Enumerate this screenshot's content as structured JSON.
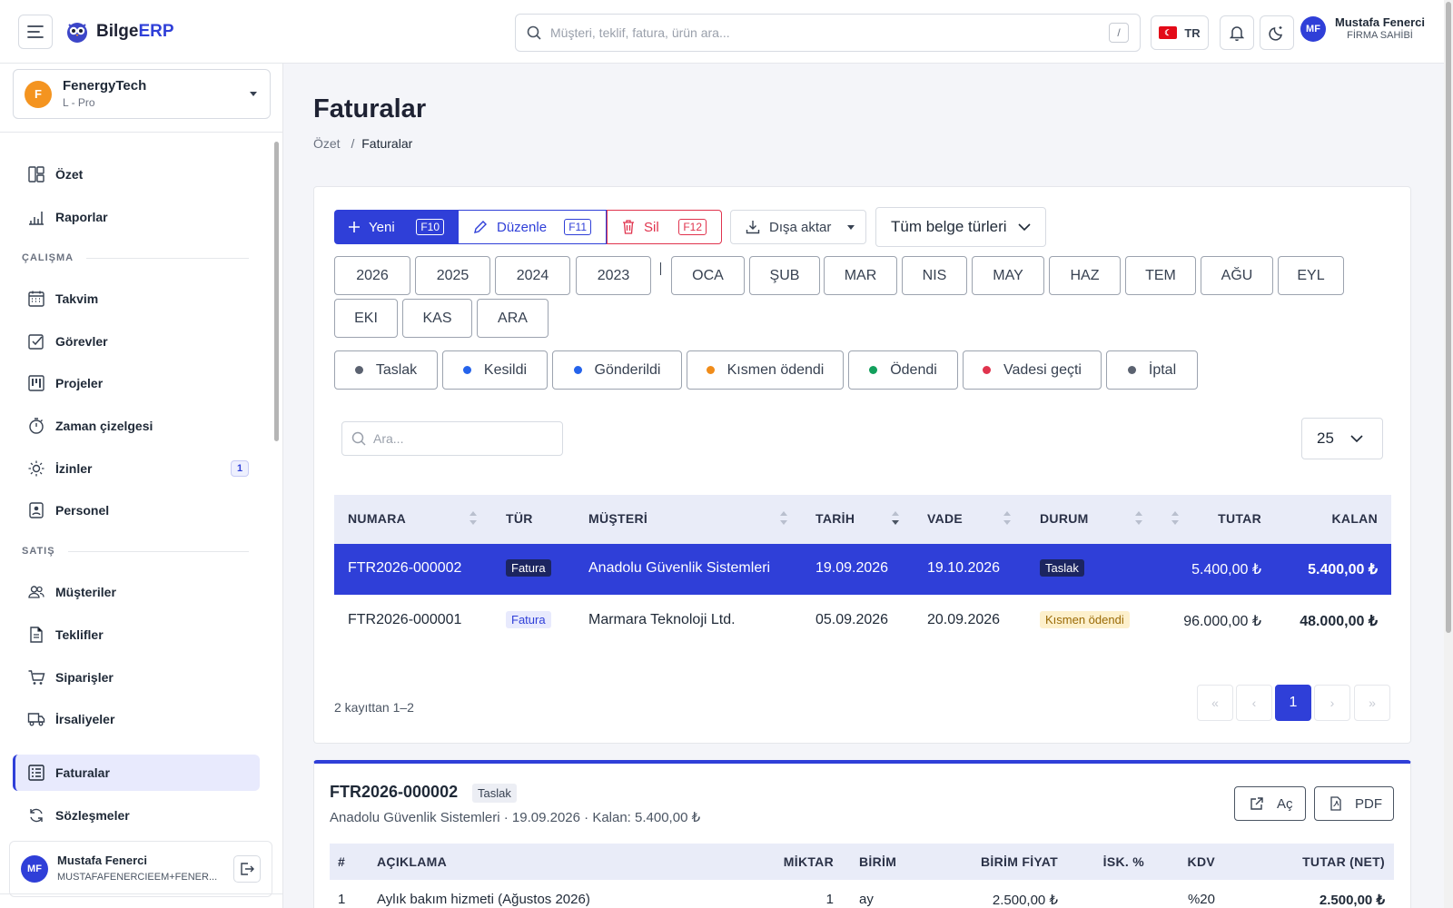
{
  "app": {
    "name_part1": "Bilge",
    "name_part2": "ERP"
  },
  "search": {
    "placeholder": "Müşteri, teklif, fatura, ürün ara...",
    "shortcut": "/"
  },
  "lang": {
    "code": "TR"
  },
  "user": {
    "initials": "MF",
    "name": "Mustafa Fenerci",
    "role": "FİRMA SAHİBİ",
    "email": "MUSTAFAFENERCIEEM+FENER..."
  },
  "company": {
    "initial": "F",
    "name": "FenergyTech",
    "plan": "L - Pro"
  },
  "sidebar": {
    "top": [
      {
        "label": "Özet",
        "icon": "layout-icon"
      },
      {
        "label": "Raporlar",
        "icon": "chart-icon"
      }
    ],
    "section_work": "ÇALIŞMA",
    "work": [
      {
        "label": "Takvim",
        "icon": "calendar-icon"
      },
      {
        "label": "Görevler",
        "icon": "checklist-icon"
      },
      {
        "label": "Projeler",
        "icon": "kanban-icon"
      },
      {
        "label": "Zaman çizelgesi",
        "icon": "stopwatch-icon"
      },
      {
        "label": "İzinler",
        "icon": "sun-icon",
        "badge": "1"
      },
      {
        "label": "Personel",
        "icon": "badge-icon"
      }
    ],
    "section_sales": "SATIŞ",
    "sales": [
      {
        "label": "Müşteriler",
        "icon": "users-icon"
      },
      {
        "label": "Teklifler",
        "icon": "document-icon"
      },
      {
        "label": "Siparişler",
        "icon": "cart-icon"
      },
      {
        "label": "İrsaliyeler",
        "icon": "truck-icon"
      },
      {
        "label": "Faturalar",
        "icon": "invoice-icon",
        "active": true
      },
      {
        "label": "Sözleşmeler",
        "icon": "refresh-icon"
      }
    ]
  },
  "page": {
    "title": "Faturalar",
    "breadcrumb_root": "Özet",
    "breadcrumb_sep": "/",
    "breadcrumb_current": "Faturalar"
  },
  "toolbar": {
    "new_label": "Yeni",
    "new_key": "F10",
    "edit_label": "Düzenle",
    "edit_key": "F11",
    "delete_label": "Sil",
    "delete_key": "F12",
    "export_label": "Dışa aktar",
    "type_filter": "Tüm belge türleri"
  },
  "filters": {
    "years": [
      "2026",
      "2025",
      "2024",
      "2023"
    ],
    "separator": "|",
    "months": [
      "OCA",
      "ŞUB",
      "MAR",
      "NIS",
      "MAY",
      "HAZ",
      "TEM",
      "AĞU",
      "EYL",
      "EKI",
      "KAS",
      "ARA"
    ],
    "statuses": [
      {
        "label": "Taslak",
        "color": "#5b6270"
      },
      {
        "label": "Kesildi",
        "color": "#2563eb"
      },
      {
        "label": "Gönderildi",
        "color": "#2563eb"
      },
      {
        "label": "Kısmen ödendi",
        "color": "#f08c1a"
      },
      {
        "label": "Ödendi",
        "color": "#12a05c"
      },
      {
        "label": "Vadesi geçti",
        "color": "#e0334d"
      },
      {
        "label": "İptal",
        "color": "#5b6270"
      }
    ]
  },
  "table": {
    "search_placeholder": "Ara...",
    "page_size": "25",
    "columns": [
      "NUMARA",
      "TÜR",
      "MÜŞTERİ",
      "TARİH",
      "VADE",
      "DURUM",
      "TUTAR",
      "KALAN"
    ],
    "rows": [
      {
        "number": "FTR2026-000002",
        "type": "Fatura",
        "customer": "Anadolu Güvenlik Sistemleri",
        "date": "19.09.2026",
        "due": "19.10.2026",
        "status": "Taslak",
        "amount": "5.400,00 ₺",
        "remaining": "5.400,00 ₺",
        "selected": true
      },
      {
        "number": "FTR2026-000001",
        "type": "Fatura",
        "customer": "Marmara Teknoloji Ltd.",
        "date": "05.09.2026",
        "due": "20.09.2026",
        "status": "Kısmen ödendi",
        "amount": "96.000,00 ₺",
        "remaining": "48.000,00 ₺",
        "selected": false
      }
    ],
    "summary": "2 kayıttan 1–2",
    "pagination": {
      "first": "«",
      "prev": "‹",
      "current": "1",
      "next": "›",
      "last": "»"
    }
  },
  "detail": {
    "number": "FTR2026-000002",
    "status": "Taslak",
    "subtitle": "Anadolu Güvenlik Sistemleri · 19.09.2026 · Kalan: 5.400,00 ₺",
    "open_label": "Aç",
    "pdf_label": "PDF",
    "columns": [
      "#",
      "AÇIKLAMA",
      "MİKTAR",
      "BİRİM",
      "BİRİM FİYAT",
      "İSK. %",
      "KDV",
      "TUTAR (NET)"
    ],
    "rows": [
      {
        "no": "1",
        "desc": "Aylık bakım hizmeti (Ağustos 2026)",
        "qty": "1",
        "unit": "ay",
        "price": "2.500,00 ₺",
        "discount": "",
        "vat": "%20",
        "net": "2.500,00 ₺"
      }
    ]
  }
}
